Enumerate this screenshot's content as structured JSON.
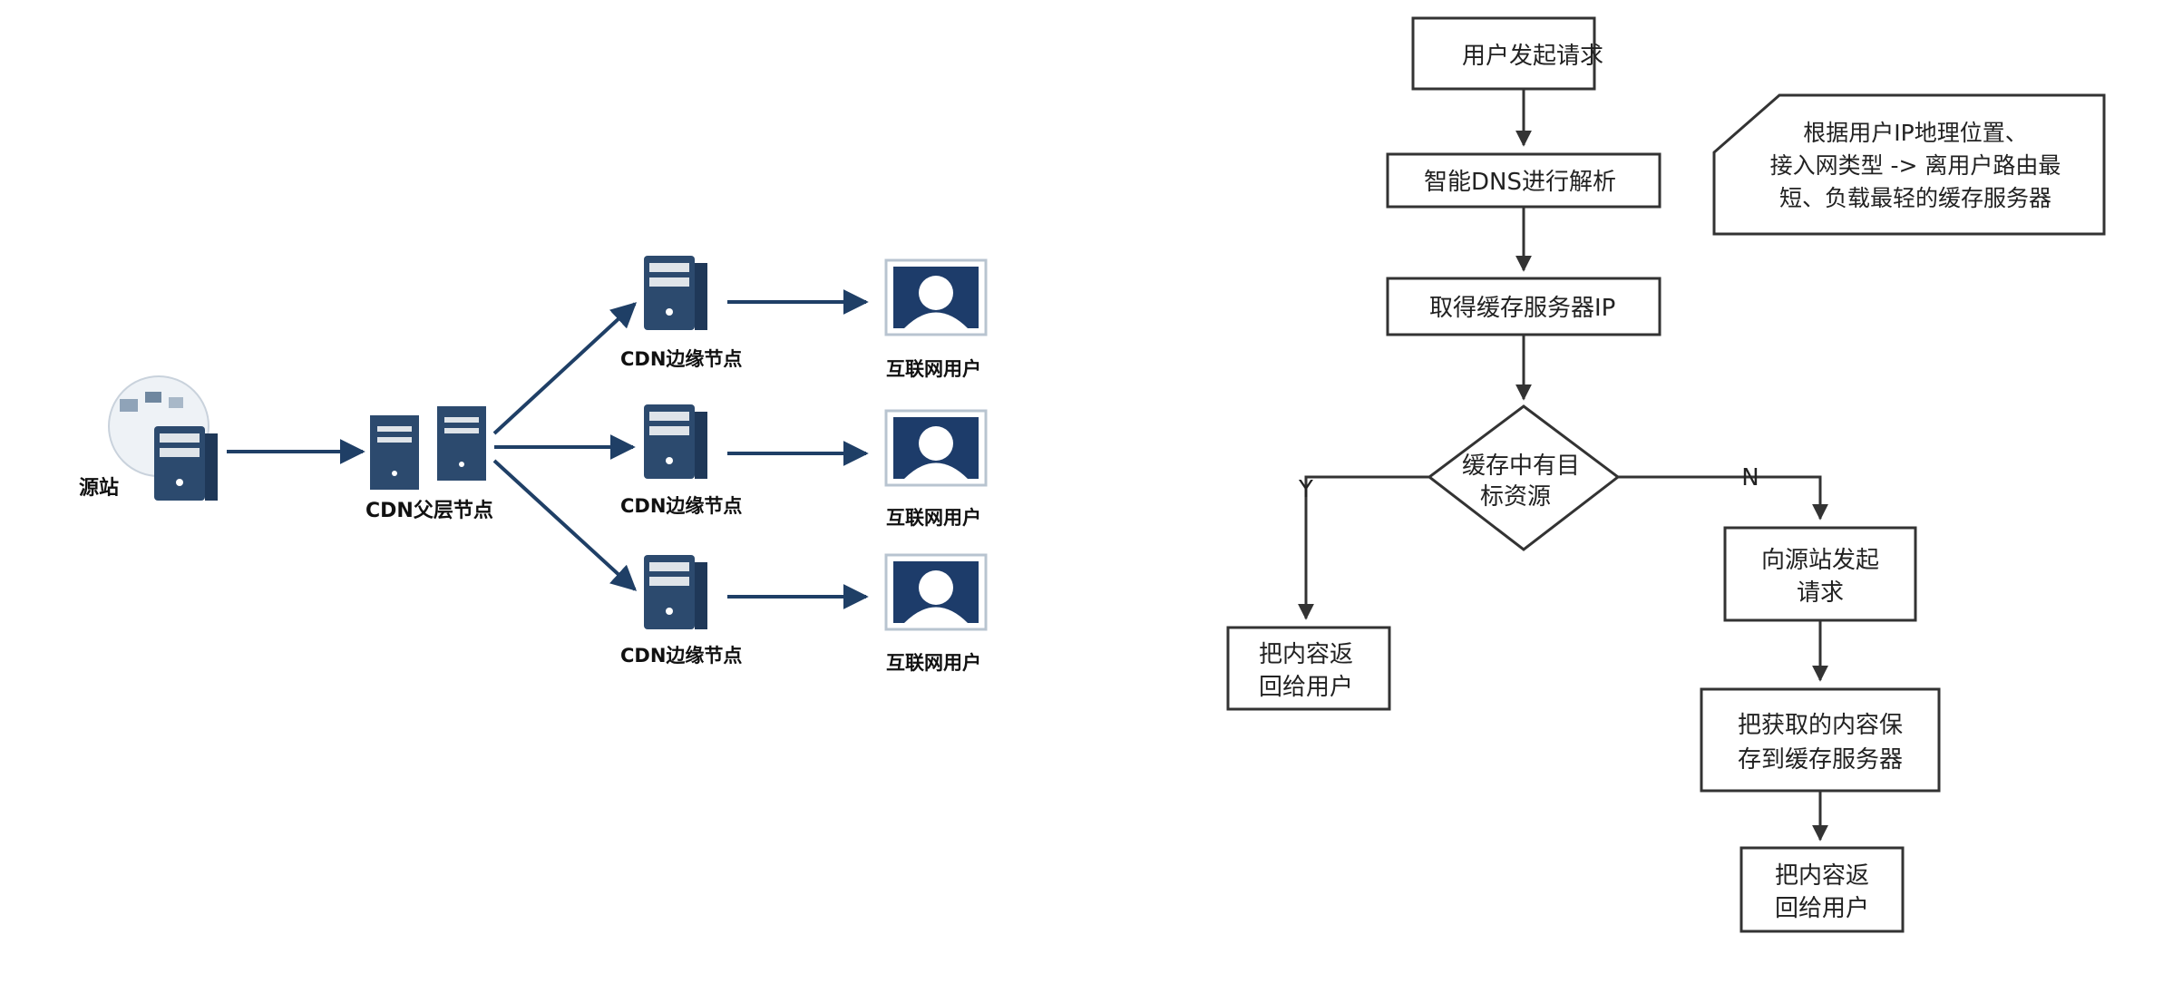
{
  "left_diagram": {
    "origin_label": "源站",
    "parent_label": "CDN父层节点",
    "edge_label": "CDN边缘节点",
    "user_label": "互联网用户",
    "edge_count": 3
  },
  "flowchart": {
    "steps": {
      "start": "用户发起请求",
      "dns": "智能DNS进行解析",
      "get_ip": "取得缓存服务器IP",
      "decision": [
        "缓存中有目",
        "标资源"
      ],
      "return_left": [
        "把内容返",
        "回给用户"
      ],
      "request_origin": [
        "向源站发起",
        "请求"
      ],
      "save_cache": [
        "把获取的内容保",
        "存到缓存服务器"
      ],
      "return_right": [
        "把内容返",
        "回给用户"
      ]
    },
    "branch_yes": "Y",
    "branch_no": "N",
    "note": [
      "根据用户IP地理位置、",
      "接入网类型 -> 离用户路由最",
      "短、负载最轻的缓存服务器"
    ]
  },
  "colors": {
    "server_navy": "#2c4a6e",
    "server_front": "#3a5f88",
    "line_navy": "#1f3f66",
    "flow_stroke": "#333333"
  }
}
